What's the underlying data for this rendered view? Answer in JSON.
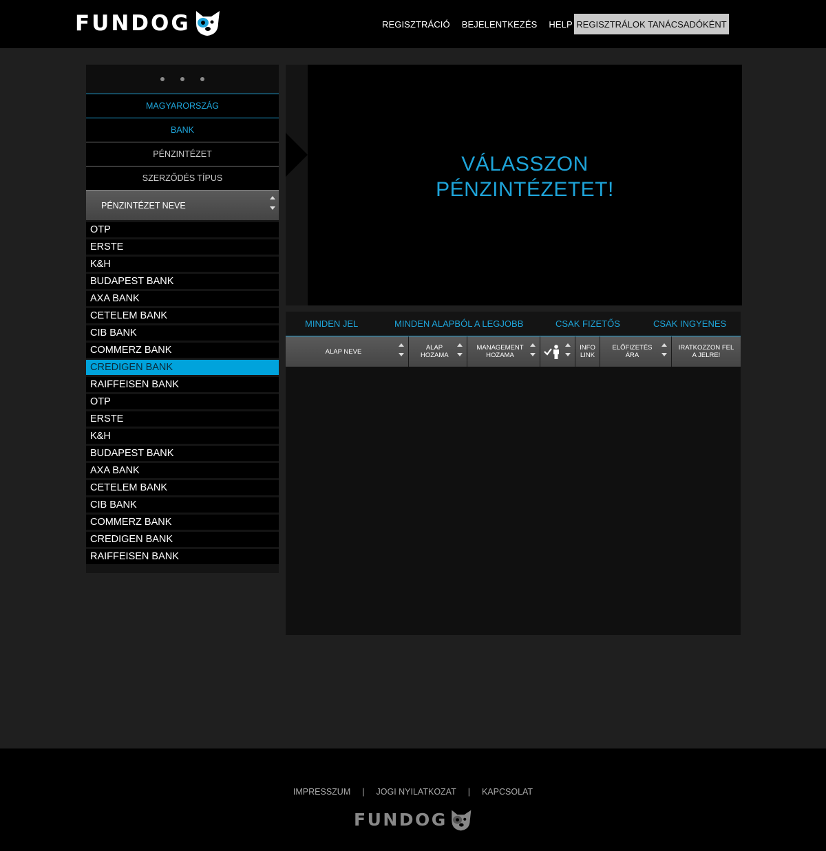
{
  "brand": {
    "name": "FUNDOG"
  },
  "nav": {
    "links": [
      "REGISZTRÁCIÓ",
      "BEJELENTKEZÉS",
      "HELP"
    ],
    "cta": "REGISZTRÁLOK TANÁCSADÓKÉNT"
  },
  "sidebar": {
    "filters": [
      "MAGYARORSZÁG",
      "BANK",
      "PÉNZINTÉZET",
      "SZERZŐDÉS TÍPUS"
    ],
    "sort_header": "PÉNZINTÉZET NEVE",
    "banks": [
      "OTP",
      "ERSTE",
      "K&H",
      "BUDAPEST BANK",
      "AXA BANK",
      "CETELEM BANK",
      "CIB BANK",
      "COMMERZ BANK",
      "CREDIGEN BANK",
      "RAIFFEISEN BANK",
      "OTP",
      "ERSTE",
      "K&H",
      "BUDAPEST BANK",
      "AXA BANK",
      "CETELEM BANK",
      "CIB BANK",
      "COMMERZ BANK",
      "CREDIGEN BANK",
      "RAIFFEISEN BANK"
    ],
    "selected_index": 8
  },
  "main": {
    "prompt_line1": "VÁLASSZON",
    "prompt_line2": "PÉNZINTÉZETET!"
  },
  "tabs": [
    "MINDEN JEL",
    "MINDEN ALAPBÓL A LEGJOBB",
    "CSAK FIZETŐS",
    "CSAK INGYENES"
  ],
  "table": {
    "columns": [
      {
        "label": "ALAP NEVE",
        "sortable": true
      },
      {
        "label": "ALAP HOZAMA",
        "sortable": true
      },
      {
        "label": "MANAGEMENT HOZAMA",
        "sortable": true
      },
      {
        "label": "",
        "sortable": true,
        "icon": "person-check-icon"
      },
      {
        "label": "INFO LINK",
        "sortable": false
      },
      {
        "label": "ELŐFIZETÉS ÁRA",
        "sortable": true
      },
      {
        "label": "IRATKOZZON FEL A JELRE!",
        "sortable": false
      }
    ]
  },
  "footer": {
    "links": [
      "IMPRESSZUM",
      "JOGI NYILATKOZAT",
      "KAPCSOLAT"
    ],
    "separator": "|"
  },
  "colors": {
    "accent": "#1ea4d9",
    "selected_row": "#00a3dc",
    "header_bg": "#000000",
    "page_bg": "#1f1f1f"
  }
}
